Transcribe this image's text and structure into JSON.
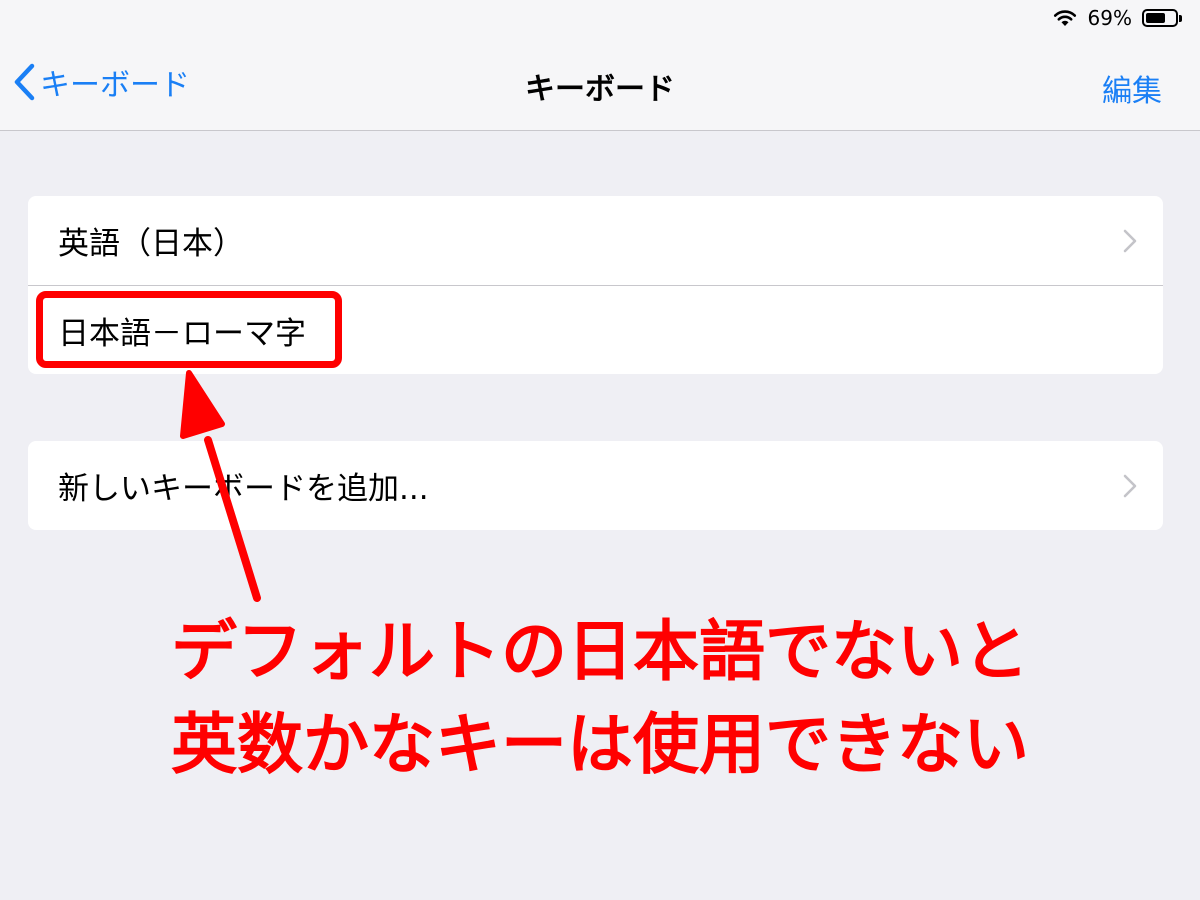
{
  "status_bar": {
    "battery_text": "69%",
    "battery_level": 0.69
  },
  "nav": {
    "back_label": "キーボード",
    "title": "キーボード",
    "edit_label": "編集"
  },
  "keyboards": {
    "items": [
      {
        "label": "英語（日本）",
        "has_chevron": true
      },
      {
        "label": "日本語－ローマ字",
        "has_chevron": false
      }
    ]
  },
  "add_keyboard": {
    "label": "新しいキーボードを追加..."
  },
  "annotation": {
    "line1": "デフォルトの日本語でないと",
    "line2": "英数かなキーは使用できない"
  },
  "colors": {
    "accent": "#1a7ff5",
    "annotation": "#ff0000",
    "background": "#efeff4"
  }
}
